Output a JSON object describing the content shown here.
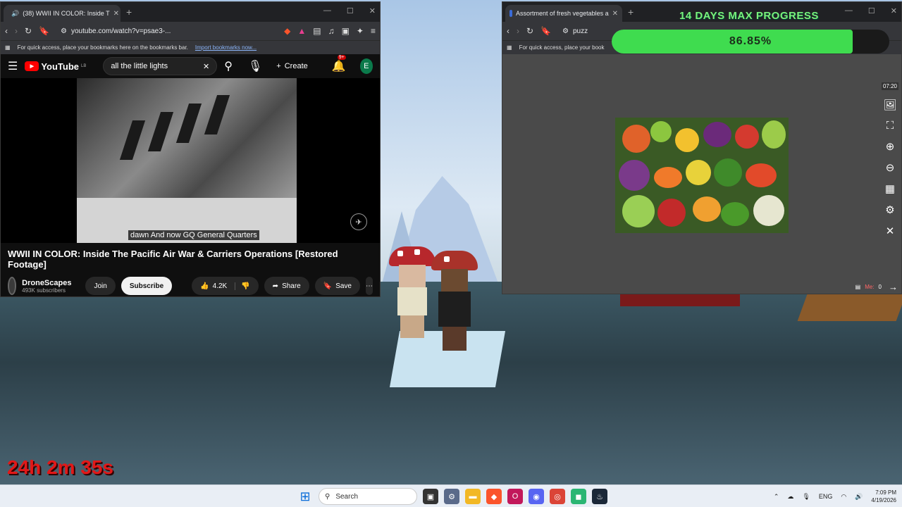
{
  "overlay": {
    "progress_title": "14 DAYS MAX PROGRESS",
    "progress_value": 0.8685,
    "progress_label": "86.85%",
    "elapsed_time": "24h 2m 35s",
    "progress_color": "#3fdc4f"
  },
  "youtube_window": {
    "tab_title": "(38) WWII IN COLOR: Inside T",
    "url": "youtube.com/watch?v=psae3-...",
    "bookmarks_hint": "For quick access, place your bookmarks here on the bookmarks bar.",
    "bookmarks_link": "Import bookmarks now...",
    "yt_logo": "YouTube",
    "yt_region": "LB",
    "search_value": "all the little lights",
    "create_label": "Create",
    "notif_count": "9+",
    "account_initial": "E",
    "caption": "dawn And now GQ General Quarters",
    "video_title": "WWII IN COLOR: Inside The Pacific Air War & Carriers Operations [Restored Footage]",
    "channel_name": "DroneScapes",
    "subscribers": "493K subscribers",
    "join_label": "Join",
    "subscribe_label": "Subscribe",
    "likes": "4.2K",
    "share_label": "Share",
    "save_label": "Save"
  },
  "puzzle_window": {
    "tab_title": "Assortment of fresh vegetables a",
    "url": "puzz",
    "bookmarks_hint": "For quick access, place your book",
    "timer": "07:20",
    "me_label": "Me:",
    "me_score": "0"
  },
  "taskbar": {
    "search_placeholder": "Search",
    "language": "ENG",
    "time": "7:09 PM",
    "date": "4/19/2026"
  }
}
